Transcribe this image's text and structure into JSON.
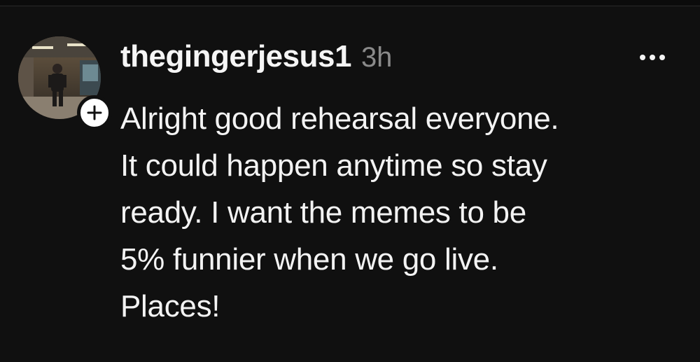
{
  "post": {
    "username": "thegingerjesus1",
    "timestamp": "3h",
    "text_lines": [
      "Alright good rehearsal everyone.",
      "It could happen anytime so stay",
      "ready. I want the memes to be",
      "5% funnier when we go live.",
      "Places!"
    ]
  },
  "icons": {
    "follow": "plus-icon",
    "more": "more-options-icon",
    "avatar": "profile-avatar"
  },
  "colors": {
    "background": "#101010",
    "text": "#f3f3f3",
    "muted": "#8a8a8a"
  }
}
